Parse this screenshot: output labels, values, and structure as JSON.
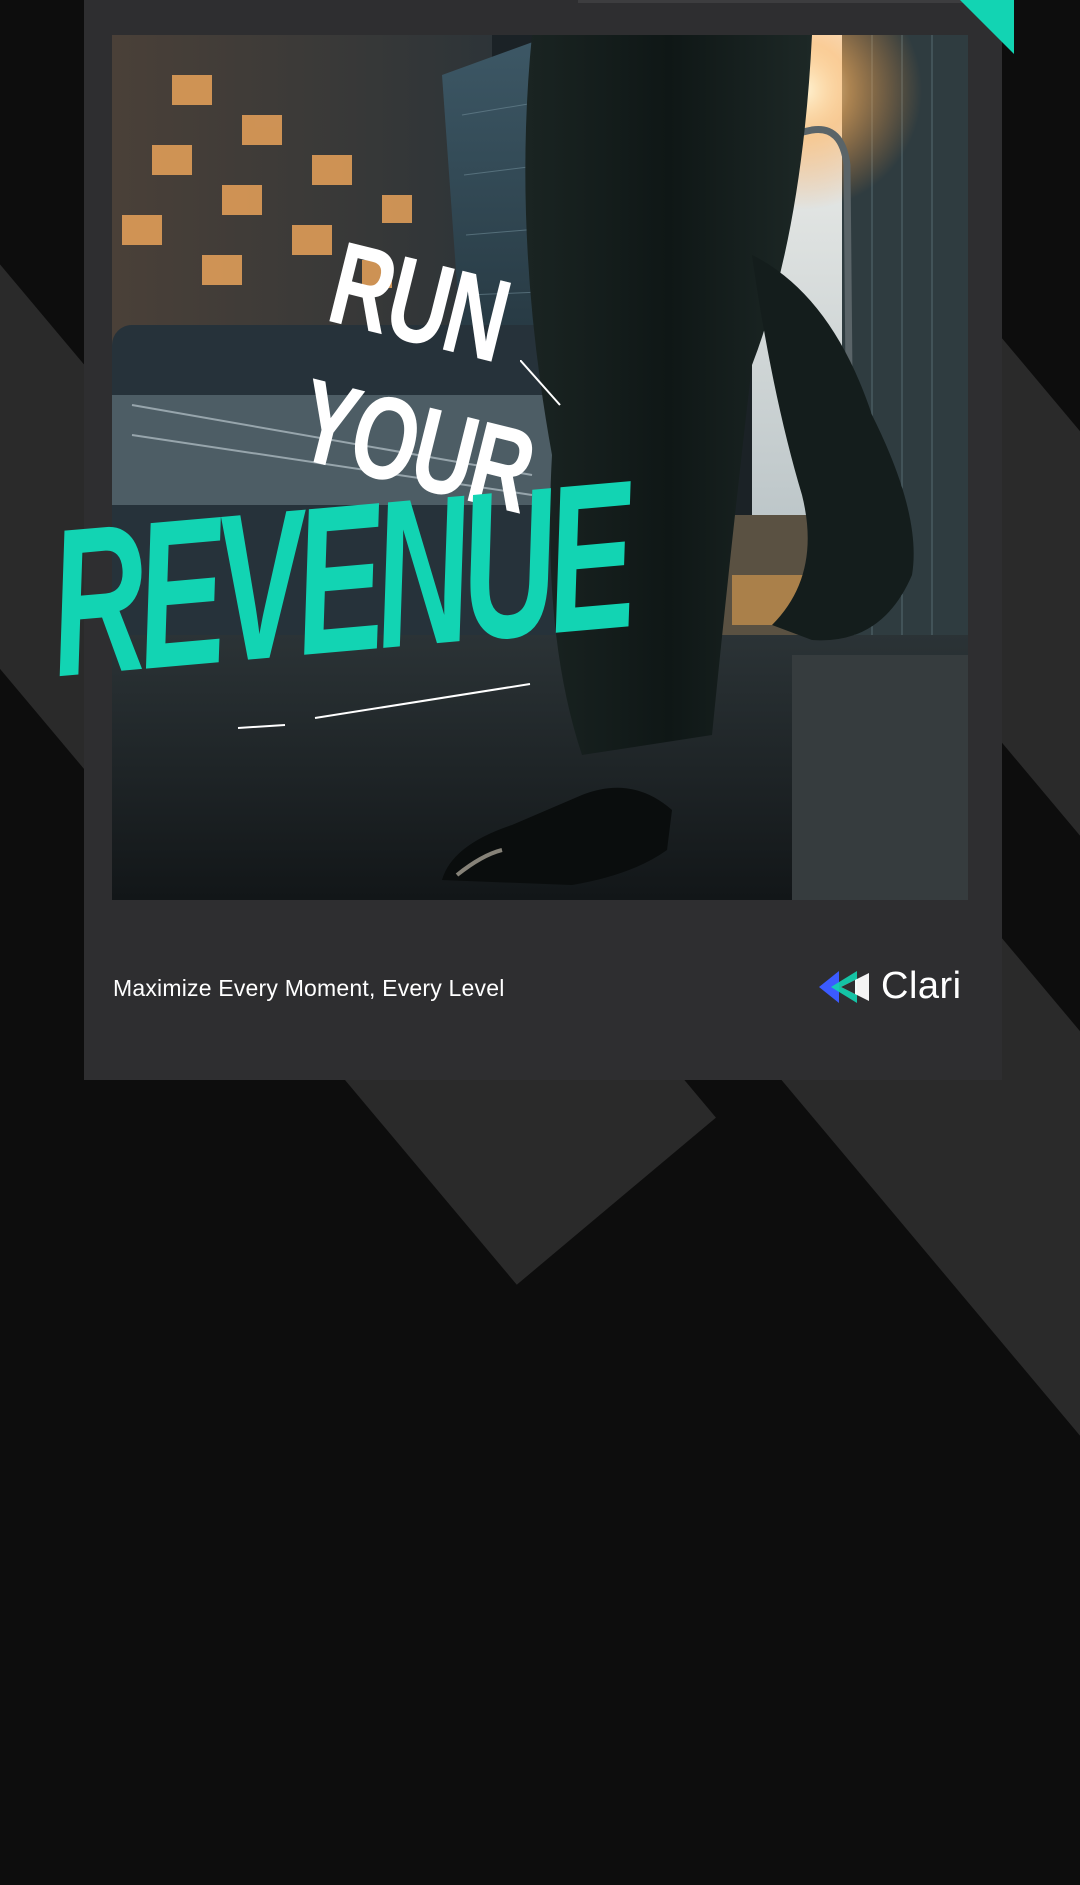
{
  "headline": {
    "line1": "RUN",
    "line2": "YOUR",
    "line3": "REVENUE"
  },
  "tagline": "Maximize Every Moment, Every Level",
  "brand": {
    "name": "Clari",
    "logo_icon": "clari-logo-icon"
  },
  "colors": {
    "accent": "#12d4b3",
    "card": "#2e2e30",
    "background": "#0d0d0d"
  }
}
